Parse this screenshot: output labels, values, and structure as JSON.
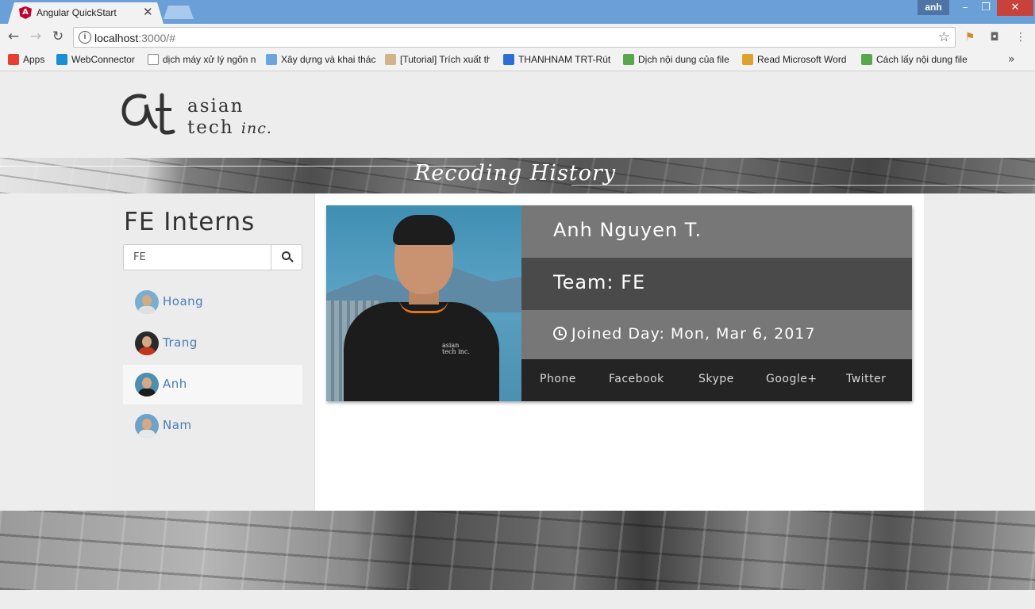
{
  "browser": {
    "tab_title": "Angular QuickStart",
    "tab_favicon_letter": "A",
    "close_glyph": "✕",
    "user": "anh",
    "url_host": "localhost",
    "url_rest": ":3000/#",
    "bookmarks": [
      {
        "label": "Apps",
        "icon": "apps-grid-icon",
        "color": "#e34133"
      },
      {
        "label": "WebConnector",
        "icon": "webconnector-icon",
        "color": "#1a8fd6"
      },
      {
        "label": "dịch máy xử lý ngôn n",
        "icon": "page-icon",
        "color": "#ffffff"
      },
      {
        "label": "Xây dựng và khai thác",
        "icon": "person-icon",
        "color": "#6aa5e0"
      },
      {
        "label": "[Tutorial] Trích xuất th",
        "icon": "avatar-icon",
        "color": "#d2b48c"
      },
      {
        "label": "THANHNAM TRT-Rút",
        "icon": "globe-icon",
        "color": "#2a6fd1"
      },
      {
        "label": "Dịch nội dung của file",
        "icon": "chrome-icon",
        "color": "#5aa64e"
      },
      {
        "label": "Read Microsoft Word",
        "icon": "m-icon",
        "color": "#e0a030"
      },
      {
        "label": "Cách lấy nội dung file",
        "icon": "chrome-icon",
        "color": "#5aa64e"
      }
    ],
    "more_glyph": "»"
  },
  "page": {
    "logo_line1": "asian",
    "logo_line2": "tech",
    "logo_inc": "inc.",
    "banner_title": "Recoding History",
    "sidebar_title": "FE Interns",
    "search_value": "FE",
    "interns": [
      {
        "name": "Hoang",
        "active": false,
        "shirt": "#e0e0e0",
        "bg": "#7aaed0"
      },
      {
        "name": "Trang",
        "active": false,
        "shirt": "#c4351d",
        "bg": "#2a2a2a"
      },
      {
        "name": "Anh",
        "active": true,
        "shirt": "#1c1c1c",
        "bg": "#4d8fb0"
      },
      {
        "name": "Nam",
        "active": false,
        "shirt": "#e8e8e8",
        "bg": "#6fa2c8"
      }
    ],
    "profile": {
      "name": "Anh Nguyen T.",
      "team": "Team: FE",
      "joined": "Joined Day: Mon, Mar 6, 2017",
      "shirt_logo_1": "asian",
      "shirt_logo_2": "tech inc.",
      "social": [
        "Phone",
        "Facebook",
        "Skype",
        "Google+",
        "Twitter"
      ]
    }
  }
}
